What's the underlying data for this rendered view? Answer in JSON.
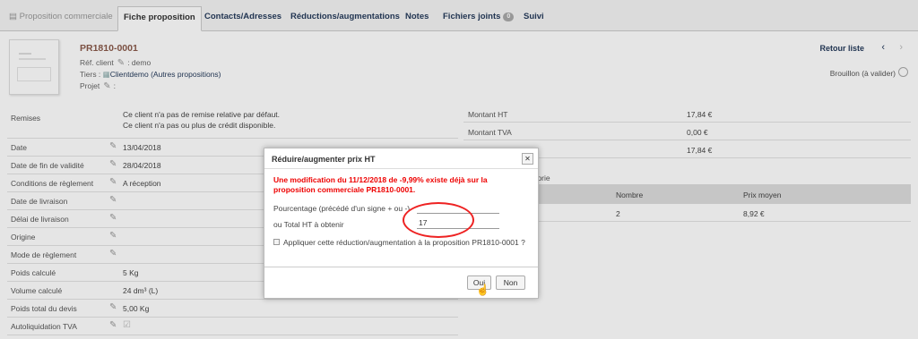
{
  "tabs": [
    {
      "label": "Proposition commerciale"
    },
    {
      "label": "Fiche proposition"
    },
    {
      "label": "Contacts/Adresses"
    },
    {
      "label": "Réductions/augmentations"
    },
    {
      "label": "Notes"
    },
    {
      "label": "Fichiers joints",
      "badge": "0"
    },
    {
      "label": "Suivi"
    }
  ],
  "header": {
    "ref": "PR1810-0001",
    "ref_client_label": "Réf. client",
    "ref_client_value": ": demo",
    "tiers_label": "Tiers :",
    "tiers_value": "Clientdemo",
    "other_props": "(Autres propositions)",
    "projet_label": "Projet",
    "projet_value": ":",
    "retour": "Retour liste",
    "status": "Brouillon (à valider)"
  },
  "remises": {
    "label": "Remises",
    "line1": "Ce client n'a pas de remise relative par défaut.",
    "line2": "Ce client n'a pas ou plus de crédit disponible."
  },
  "rows": [
    {
      "label": "Date",
      "value": "13/04/2018"
    },
    {
      "label": "Date de fin de validité",
      "value": "28/04/2018"
    },
    {
      "label": "Conditions de règlement",
      "value": "A réception"
    },
    {
      "label": "Date de livraison",
      "value": ""
    },
    {
      "label": "Délai de livraison",
      "value": ""
    },
    {
      "label": "Origine",
      "value": ""
    },
    {
      "label": "Mode de règlement",
      "value": ""
    },
    {
      "label": "Poids calculé",
      "value": "5 Kg"
    },
    {
      "label": "Volume calculé",
      "value": "24 dm³ (L)"
    },
    {
      "label": "Poids total du devis",
      "value": "5,00 Kg"
    },
    {
      "label": "Autoliquidation TVA",
      "value": ""
    }
  ],
  "amounts": [
    {
      "label": "Montant HT",
      "value": "17,84 €"
    },
    {
      "label": "Montant TVA",
      "value": "0,00 €"
    },
    {
      "label": "",
      "value": "17,84 €"
    }
  ],
  "category": {
    "title": "égorie",
    "headers": [
      "Nombre",
      "Prix moyen"
    ],
    "row": [
      "2",
      "8,92 €"
    ]
  },
  "dialog": {
    "title": "Réduire/augmenter prix HT",
    "close": "✕",
    "warning": "Une modification du 11/12/2018 de -9,99% existe déjà sur la proposition commerciale PR1810-0001.",
    "percent_label": "Pourcentage (précédé d'un signe + ou -)",
    "percent_value": "",
    "total_label": "ou Total HT à obtenir",
    "total_value": "17",
    "apply_label": "Appliquer cette réduction/augmentation à la proposition PR1810-0001 ?",
    "yes": "Oui",
    "no": "Non"
  },
  "colors": {
    "accent": "#263c5c",
    "warning": "#e00000",
    "ref": "#8a5a4a",
    "highlight": "#e22222"
  }
}
